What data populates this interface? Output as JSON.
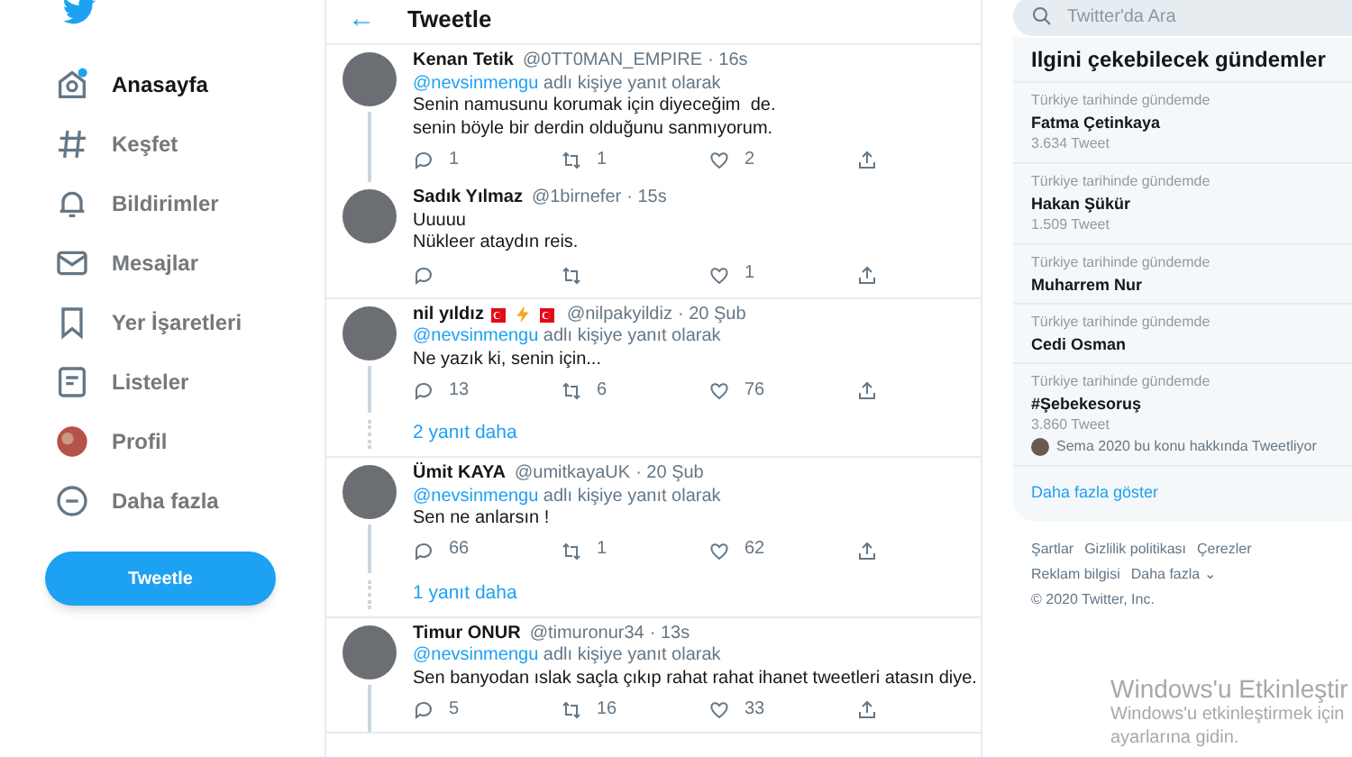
{
  "nav": {
    "items": [
      {
        "label": "Anasayfa",
        "selected": true
      },
      {
        "label": "Keşfet",
        "selected": false
      },
      {
        "label": "Bildirimler",
        "selected": false
      },
      {
        "label": "Mesajlar",
        "selected": false
      },
      {
        "label": "Yer İşaretleri",
        "selected": false
      },
      {
        "label": "Listeler",
        "selected": false
      },
      {
        "label": "Profil",
        "selected": false
      },
      {
        "label": "Daha fazla",
        "selected": false
      }
    ],
    "tweet_button": "Tweetle"
  },
  "header": {
    "back": "←",
    "title": "Tweetle"
  },
  "tweets": [
    {
      "name": "Kenan Tetik",
      "handle": "@0TT0MAN_EMPIRE",
      "time": "· 16s",
      "mention": "@nevsinmengu",
      "reply_note": "adlı kişiye yanıt olarak",
      "lines": [
        "Senin namusunu korumak için diyeceğim  de.",
        "senin böyle bir derdin olduğunu sanmıyorum."
      ],
      "replies": "1",
      "retweets": "1",
      "likes": "2",
      "thread_below": true
    },
    {
      "name": "Sadık Yılmaz",
      "handle": "@1birnefer",
      "time": "· 15s",
      "lines": [
        "Uuuuu",
        "Nükleer ataydın reis."
      ],
      "likes": "1",
      "thread_below": false
    },
    {
      "name": "nil yıldız",
      "name_icons": [
        {
          "kind": "flag"
        },
        {
          "kind": "bolt"
        },
        {
          "kind": "flag"
        }
      ],
      "handle": "@nilpakyildiz",
      "time": "· 20 Şub",
      "mention": "@nevsinmengu",
      "reply_note": "adlı kişiye yanıt olarak",
      "lines": [
        "Ne yazık ki, senin için..."
      ],
      "replies": "13",
      "retweets": "6",
      "likes": "76",
      "thread_below": true,
      "more_replies": "2 yanıt daha"
    },
    {
      "name": "Ümit KAYA",
      "handle": "@umitkayaUK",
      "time": "· 20 Şub",
      "mention": "@nevsinmengu",
      "reply_note": "adlı kişiye yanıt olarak",
      "lines": [
        "Sen ne anlarsın !"
      ],
      "replies": "66",
      "retweets": "1",
      "likes": "62",
      "thread_below": true,
      "more_replies": "1 yanıt daha"
    },
    {
      "name": "Timur ONUR",
      "handle": "@timuronur34",
      "time": "· 13s",
      "mention": "@nevsinmengu",
      "reply_note": "adlı kişiye yanıt olarak",
      "lines": [
        "Sen banyodan ıslak saçla çıkıp rahat rahat ihanet tweetleri atasın diye."
      ],
      "replies": "5",
      "retweets": "16",
      "likes": "33",
      "thread_below": true
    }
  ],
  "search": {
    "placeholder": "Twitter'da Ara"
  },
  "trends": {
    "title": "Ilgini çekebilecek gündemler",
    "items": [
      {
        "context": "Türkiye tarihinde gündemde",
        "topic": "Fatma Çetinkaya",
        "count": "3.634 Tweet"
      },
      {
        "context": "Türkiye tarihinde gündemde",
        "topic": "Hakan Şükür",
        "count": "1.509 Tweet"
      },
      {
        "context": "Türkiye tarihinde gündemde",
        "topic": "Muharrem Nur"
      },
      {
        "context": "Türkiye tarihinde gündemde",
        "topic": "Cedi Osman"
      },
      {
        "context": "Türkiye tarihinde gündemde",
        "topic": "#Şebekesoruş",
        "count": "3.860 Tweet",
        "tweeting": "Sema 2020 bu konu hakkında Tweetliyor"
      }
    ],
    "show_more": "Daha fazla göster"
  },
  "footer": {
    "links": [
      "Şartlar",
      "Gizlilik politikası",
      "Çerezler",
      "Reklam bilgisi",
      "Daha fazla ⌄"
    ],
    "copyright": "© 2020 Twitter, Inc."
  },
  "activation": {
    "title": "Windows'u Etkinleştir",
    "line1": "Windows'u etkinleştirmek için",
    "line2": "ayarlarına gidin."
  }
}
